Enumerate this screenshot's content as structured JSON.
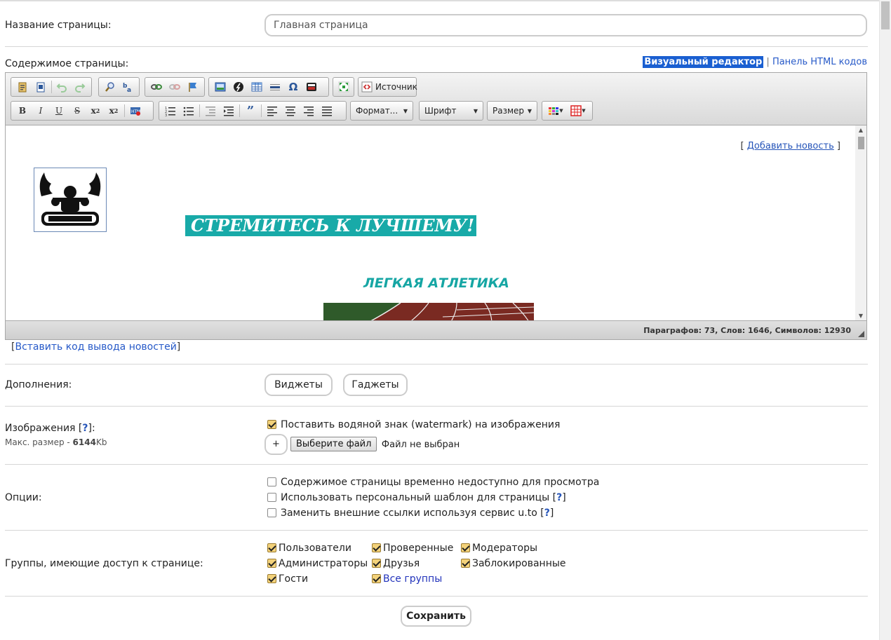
{
  "page_name": {
    "label": "Название страницы:",
    "value": "Главная страница"
  },
  "content": {
    "label": "Содержимое страницы:",
    "mode_visual": "Визуальный редактор",
    "mode_separator": "|",
    "mode_html": "Панель HTML кодов"
  },
  "editor": {
    "toolbar": {
      "source_label": "Источник",
      "format_label": "Формат...",
      "font_label": "Шрифт",
      "size_label": "Размер",
      "bold": "B",
      "italic": "I",
      "underline": "U",
      "strike": "S"
    },
    "body": {
      "add_news_open": "[",
      "add_news_link": "Добавить новость",
      "add_news_close": "]",
      "banner_text": "СТРЕМИТЕСЬ К ЛУЧШЕМУ!",
      "sport_heading": "ЛЕГКАЯ АТЛЕТИКА"
    },
    "status_bar": "Параграфов: 73, Слов: 1646, Символов: 12930"
  },
  "insert_code": {
    "open": "[",
    "link": "Вставить код вывода новостей",
    "close": "]"
  },
  "addons": {
    "label": "Дополнения:",
    "widgets_button": "Виджеты",
    "gadgets_button": "Гаджеты"
  },
  "images": {
    "label": "Изображения [",
    "help": "?",
    "label_end": "]:",
    "max_size_prefix": "Макс. размер - ",
    "max_size_value": "6144",
    "max_size_unit": "Kb",
    "watermark_label": "Поставить водяной знак (watermark) на изображения",
    "watermark_checked": true,
    "add_button": "+",
    "choose_file_button": "Выберите файл",
    "no_file_text": "Файл не выбран"
  },
  "options": {
    "label": "Опции:",
    "items": [
      {
        "label": "Содержимое страницы временно недоступно для просмотра",
        "help": "",
        "checked": false
      },
      {
        "label": "Использовать персональный шаблон для страницы [",
        "help": "?",
        "close": "]",
        "checked": false
      },
      {
        "label": "Заменить внешние ссылки используя сервис u.to [",
        "help": "?",
        "close": "]",
        "checked": false
      }
    ]
  },
  "groups": {
    "label": "Группы, имеющие доступ к странице:",
    "items": [
      {
        "label": "Пользователи",
        "checked": true
      },
      {
        "label": "Проверенные",
        "checked": true
      },
      {
        "label": "Модераторы",
        "checked": true
      },
      {
        "label": "Администраторы",
        "checked": true
      },
      {
        "label": "Друзья",
        "checked": true
      },
      {
        "label": "Заблокированные",
        "checked": true
      },
      {
        "label": "Гости",
        "checked": true
      },
      {
        "label": "Все группы",
        "checked": true
      }
    ]
  },
  "save_button": "Сохранить",
  "colors": {
    "accent_link": "#2659c8",
    "banner_bg": "#18aaa8",
    "heading_teal": "#16a6a4",
    "active_mode_bg": "#1a5fd1"
  }
}
